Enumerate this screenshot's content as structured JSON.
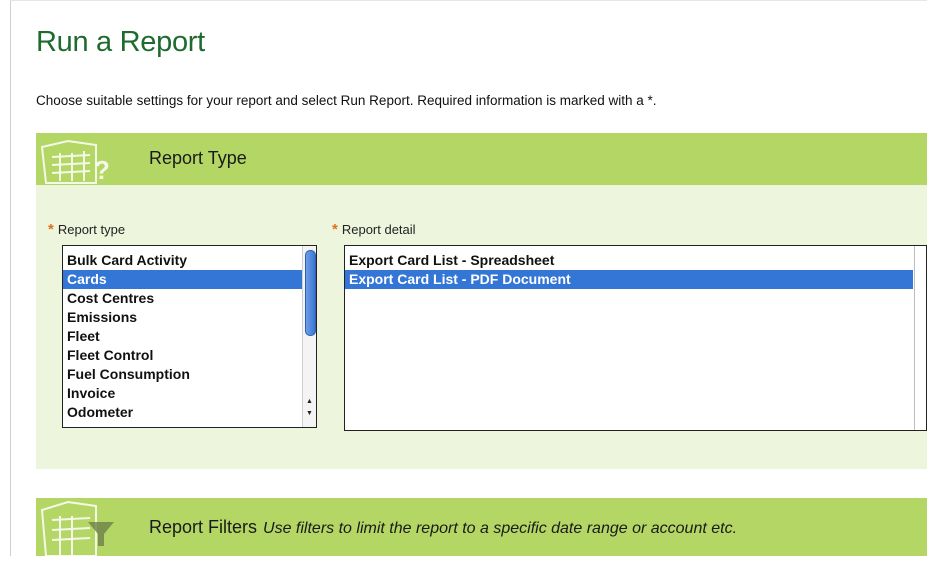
{
  "page": {
    "title": "Run a Report",
    "intro": "Choose suitable settings for your report and select Run Report. Required information is marked with a *."
  },
  "report_type_panel": {
    "heading": "Report Type",
    "report_type_label": "Report type",
    "report_detail_label": "Report detail",
    "required_marker": "*",
    "report_types": [
      {
        "label": "Bulk Card Activity",
        "selected": false
      },
      {
        "label": "Cards",
        "selected": true
      },
      {
        "label": "Cost Centres",
        "selected": false
      },
      {
        "label": "Emissions",
        "selected": false
      },
      {
        "label": "Fleet",
        "selected": false
      },
      {
        "label": "Fleet Control",
        "selected": false
      },
      {
        "label": "Fuel Consumption",
        "selected": false
      },
      {
        "label": "Invoice",
        "selected": false
      },
      {
        "label": "Odometer",
        "selected": false
      }
    ],
    "report_details": [
      {
        "label": "Export Card List - Spreadsheet",
        "selected": false
      },
      {
        "label": "Export Card List - PDF Document",
        "selected": true
      }
    ]
  },
  "report_filters_panel": {
    "heading": "Report Filters",
    "note": "Use filters to limit the report to a specific date range or account etc."
  },
  "colors": {
    "title_green": "#1f6b2f",
    "header_green": "#b4d665",
    "panel_bg": "#eef5dd",
    "selection_blue": "#3476d6",
    "required_orange": "#e0701a"
  },
  "icons": {
    "report_type": "spreadsheet-question-icon",
    "report_filters": "spreadsheet-filter-icon"
  }
}
